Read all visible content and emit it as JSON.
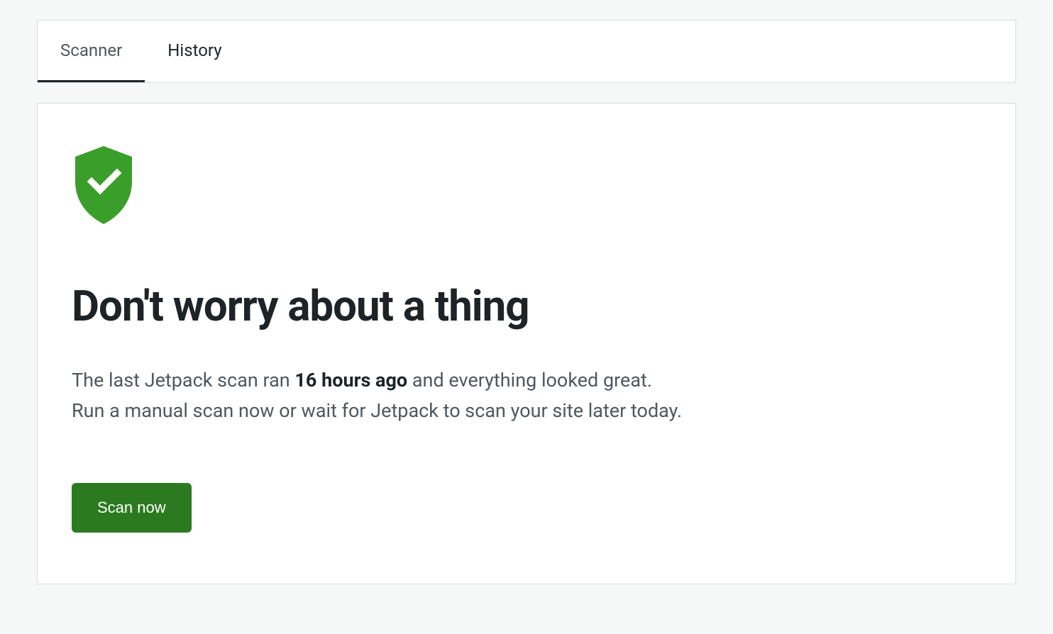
{
  "tabs": {
    "scanner": "Scanner",
    "history": "History"
  },
  "status": {
    "icon": "shield-check",
    "headline": "Don't worry about a thing",
    "description_prefix": "The last Jetpack scan ran ",
    "last_scan_time": "16 hours ago",
    "description_middle": " and everything looked great.",
    "description_line2": "Run a manual scan now or wait for Jetpack to scan your site later today."
  },
  "actions": {
    "scan_now_label": "Scan now"
  },
  "colors": {
    "accent_green": "#3a9e2a",
    "button_green": "#2c7a1f"
  }
}
